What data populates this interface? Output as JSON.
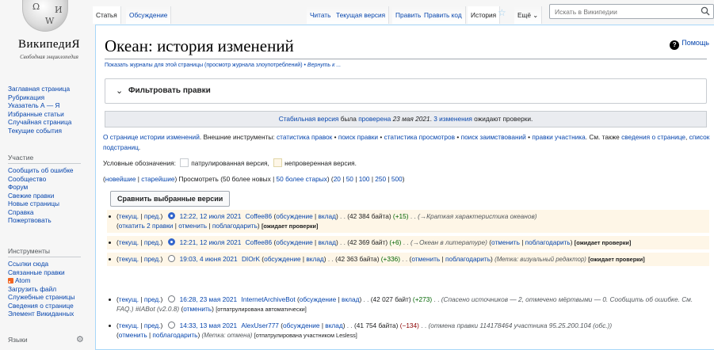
{
  "sidebar": {
    "logo": {
      "wordmark": "ВикипедиЯ",
      "tagline": "Свободная энциклопедия",
      "globe_glyphs": [
        "Ω",
        "W",
        "И"
      ]
    },
    "main_links": [
      "Заглавная страница",
      "Рубрикация",
      "Указатель А — Я",
      "Избранные статьи",
      "Случайная страница",
      "Текущие события"
    ],
    "participation": {
      "heading": "Участие",
      "links": [
        "Сообщить об ошибке",
        "Сообщество",
        "Форум",
        "Свежие правки",
        "Новые страницы",
        "Справка",
        "Пожертвовать"
      ]
    },
    "tools": {
      "heading": "Инструменты",
      "links": [
        "Ссылки сюда",
        "Связанные правки",
        "Atom",
        "Загрузить файл",
        "Служебные страницы",
        "Сведения о странице",
        "Элемент Викиданных"
      ]
    },
    "languages": {
      "heading": "Языки",
      "gear_icon": "gear-icon"
    }
  },
  "tabs": {
    "article": "Статья",
    "talk": "Обсуждение",
    "read": "Читать",
    "current_version": "Текущая версия",
    "edit": "Править",
    "edit_code": "Править код",
    "history": "История",
    "more": "Ещё ⌄",
    "watch_icon": "star-icon"
  },
  "search": {
    "placeholder": "Искать в Википедии",
    "icon": "search-icon"
  },
  "page": {
    "title": "Океан: история изменений",
    "help": "Помощь",
    "log_links_text": "Показать журналы для этой страницы (просмотр журнала злоупотреблений) •",
    "log_links_back": "Вернуть к ...",
    "filter_label": "Фильтровать правки",
    "filter_chevron": "⌄",
    "stable_notice": {
      "link1": "Стабильная версия",
      "text1": " была ",
      "link2": "проверена",
      "date": " 23 мая 2021",
      "text2": ". ",
      "link3": "3 изменения",
      "text3": " ожидают проверки."
    },
    "info": {
      "link_about": "О странице истории изменений",
      "ext_tools": ". Внешние инструменты: ",
      "tools": [
        "статистика правок",
        "поиск правки",
        "статистика просмотров",
        "поиск заимствований",
        "правки участника"
      ],
      "see_also": ". См. также ",
      "link_info": "сведения о странице",
      "link_subpages": "список подстраниц"
    },
    "legend": {
      "prefix": "Условные обозначения:",
      "patrolled": "патрулированная версия,",
      "unpatrolled": "непроверенная версия."
    },
    "nav": {
      "newest": "новейшие",
      "oldest": "старейшие",
      "view": "Просмотреть (50 более новых |",
      "older": "50 более старых",
      "limits": [
        "20",
        "50",
        "100",
        "250",
        "500"
      ]
    },
    "compare_button": "Сравнить выбранные версии"
  },
  "revisions": [
    {
      "cur": "текущ.",
      "prev": "пред.",
      "checked": true,
      "date": "12:22, 12 июля 2021",
      "user": "Coffee86",
      "talk": "обсуждение",
      "contribs": "вклад",
      "size": "42 384 байта",
      "diff": "+15",
      "diff_sign": "pos",
      "summary": "(→Краткая характеристика океанов)",
      "actions": [
        "откатить 2 правки",
        "отменить",
        "поблагодарить"
      ],
      "tag": "[ожидает проверки]",
      "unpatrolled": true
    },
    {
      "cur": "текущ.",
      "prev": "пред.",
      "checked": true,
      "date": "12:21, 12 июля 2021",
      "user": "Coffee86",
      "talk": "обсуждение",
      "contribs": "вклад",
      "size": "42 369 байт",
      "diff": "+6",
      "diff_sign": "pos",
      "summary": "(→Океан в литературе)",
      "actions": [
        "отменить",
        "поблагодарить"
      ],
      "tag": "[ожидает проверки]",
      "unpatrolled": true
    },
    {
      "cur": "текущ.",
      "prev": "пред.",
      "checked": false,
      "date": "19:03, 4 июня 2021",
      "user": "DIOrK",
      "talk": "обсуждение",
      "contribs": "вклад",
      "size": "42 363 байта",
      "diff": "+336",
      "diff_sign": "pos",
      "summary": "",
      "actions": [
        "отменить",
        "поблагодарить"
      ],
      "meta": "(Метка: визуальный редактор)",
      "tag": "[ожидает проверки]",
      "unpatrolled": true
    },
    {
      "cur": "текущ.",
      "prev": "пред.",
      "checked": false,
      "date": "16:28, 23 мая 2021",
      "user": "InternetArchiveBot",
      "talk": "обсуждение",
      "contribs": "вклад",
      "size": "42 027 байт",
      "diff": "+273",
      "diff_sign": "pos",
      "summary": "(Спасено источников — 2, отмечено мёртвыми — 0. Сообщить об ошибке. См. FAQ.) #IABot (v2.0.8)",
      "actions": [
        "отменить"
      ],
      "tag": "[отпатрулирована автоматически]",
      "unpatrolled": false
    },
    {
      "cur": "текущ.",
      "prev": "пред.",
      "checked": false,
      "date": "14:33, 13 мая 2021",
      "user": "AlexUser777",
      "talk": "обсуждение",
      "contribs": "вклад",
      "size": "41 754 байта",
      "diff": "−134",
      "diff_sign": "neg",
      "summary": "(отмена правки 114178464 участника 95.25.200.104 (обс.))",
      "actions": [
        "отменить",
        "поблагодарить"
      ],
      "meta": "(Метка: отмена)",
      "tag": "[отпатрулирована участником Lesless]",
      "unpatrolled": false
    }
  ]
}
